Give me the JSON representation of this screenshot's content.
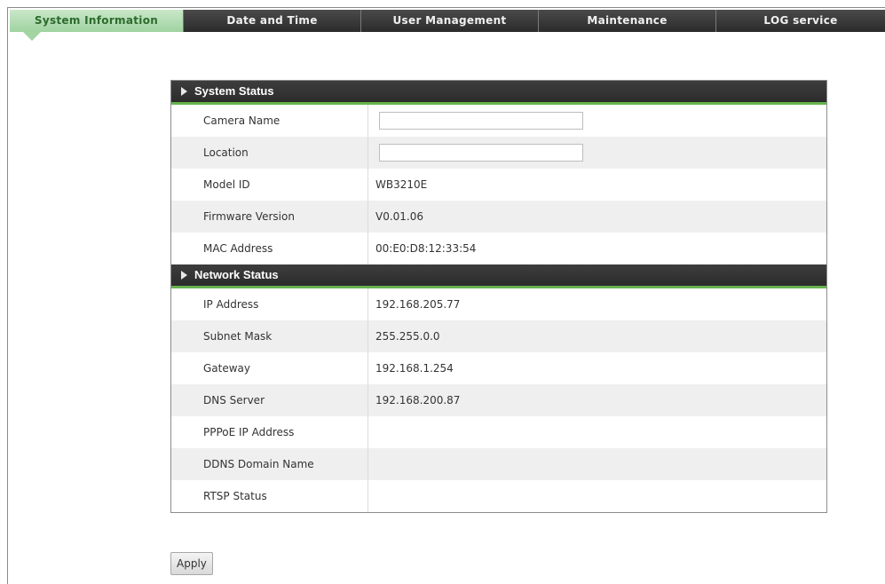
{
  "tabs": [
    {
      "label": "System Information",
      "active": true
    },
    {
      "label": "Date and Time",
      "active": false
    },
    {
      "label": "User Management",
      "active": false
    },
    {
      "label": "Maintenance",
      "active": false
    },
    {
      "label": "LOG service",
      "active": false
    }
  ],
  "system_status": {
    "title": "System Status",
    "camera_name": {
      "label": "Camera Name",
      "value": ""
    },
    "location": {
      "label": "Location",
      "value": ""
    },
    "model_id": {
      "label": "Model ID",
      "value": "WB3210E"
    },
    "firmware_version": {
      "label": "Firmware Version",
      "value": "V0.01.06"
    },
    "mac_address": {
      "label": "MAC Address",
      "value": "00:E0:D8:12:33:54"
    }
  },
  "network_status": {
    "title": "Network Status",
    "ip_address": {
      "label": "IP Address",
      "value": "192.168.205.77"
    },
    "subnet_mask": {
      "label": "Subnet Mask",
      "value": "255.255.0.0"
    },
    "gateway": {
      "label": "Gateway",
      "value": "192.168.1.254"
    },
    "dns_server": {
      "label": "DNS Server",
      "value": "192.168.200.87"
    },
    "pppoe_ip": {
      "label": "PPPoE IP Address",
      "value": ""
    },
    "ddns_domain": {
      "label": "DDNS Domain Name",
      "value": ""
    },
    "rtsp_status": {
      "label": "RTSP Status",
      "value": ""
    }
  },
  "apply_label": "Apply",
  "colors": {
    "active_tab": "#a3d4a4",
    "header_bg": "#333333",
    "header_accent": "#66b44e"
  }
}
